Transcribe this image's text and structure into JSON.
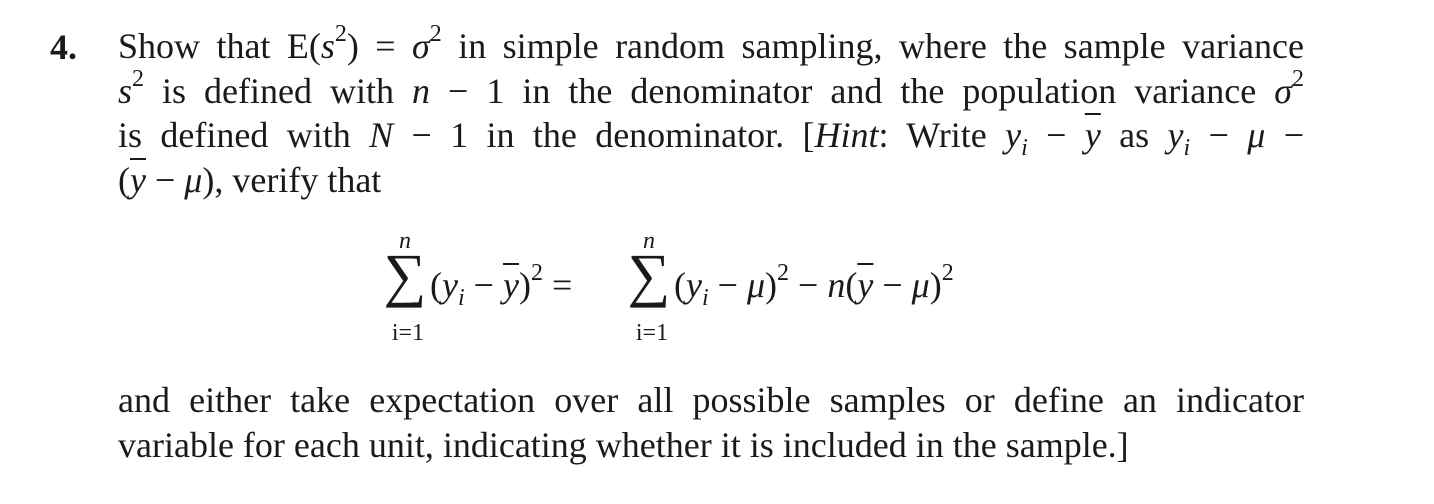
{
  "problem": {
    "number": "4.",
    "lines": [
      [
        "Show that E(",
        "s",
        "2",
        ") = ",
        "σ",
        "2",
        " in simple random sampling, where the sample variance"
      ],
      [
        "s",
        "2",
        " is defined with ",
        "n",
        " − 1 in the denominator and the population variance ",
        "σ",
        "2"
      ],
      [
        "is defined with ",
        "N",
        " − 1 in the denominator. [",
        "Hint",
        ": Write ",
        "y",
        "i",
        " − ",
        "y",
        " as ",
        "y",
        "i",
        " − ",
        "μ",
        " −"
      ],
      [
        "(",
        "y",
        " − ",
        "μ",
        "), verify that"
      ]
    ],
    "equation": {
      "lhs_sum": {
        "upper": "n",
        "lower": "i=1",
        "symbol": "∑"
      },
      "lhs_term": [
        "(",
        "y",
        "i",
        " − ",
        "y",
        ")",
        "2",
        " = "
      ],
      "rhs_sum": {
        "upper": "n",
        "lower": "i=1",
        "symbol": "∑"
      },
      "rhs_term": [
        "(",
        "y",
        "i",
        " − ",
        "μ",
        ")",
        "2",
        " − ",
        "n",
        "(",
        "y",
        " − ",
        "μ",
        ")",
        "2"
      ]
    },
    "closing_lines": [
      "and either take expectation over all possible samples or define an indicator",
      "variable for each unit, indicating whether it is included in the sample.]"
    ]
  }
}
